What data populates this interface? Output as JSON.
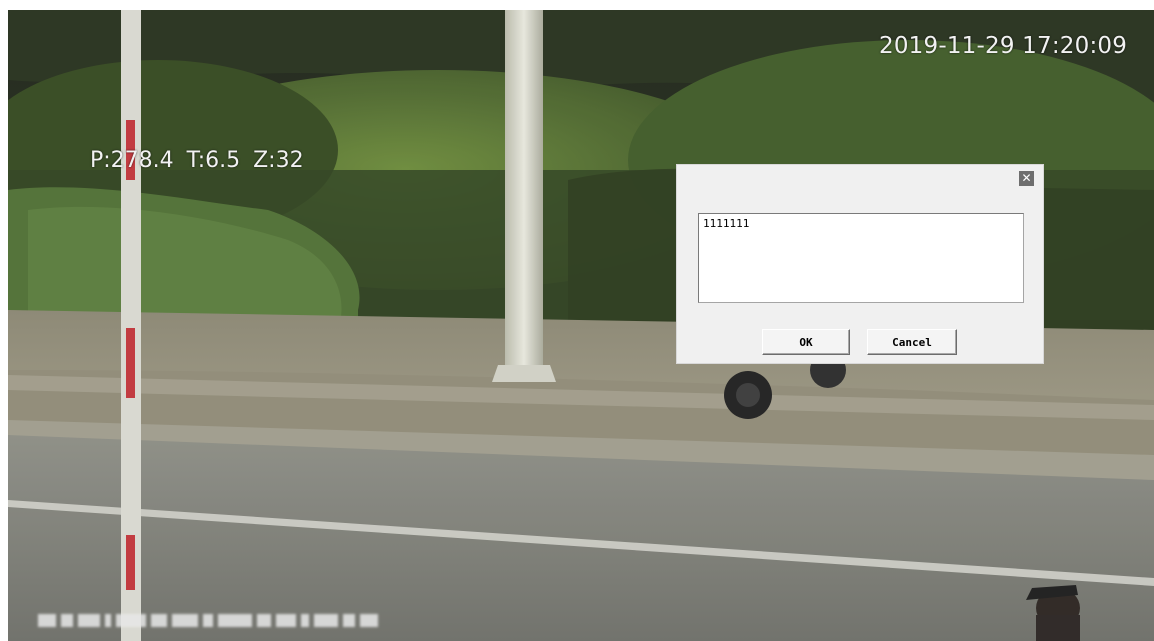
{
  "video": {
    "timestamp": "2019-11-29 17:20:09",
    "ptz": {
      "pan": "P:278.4",
      "tilt": "T:6.5",
      "zoom": "Z:32"
    }
  },
  "dialog": {
    "input_value": "1111111",
    "ok_label": "OK",
    "cancel_label": "Cancel",
    "close_glyph": "✕",
    "close_icon": "close-icon"
  },
  "colors": {
    "osd_text": "#f2f2f2",
    "dialog_background": "#f0f0f0",
    "close_button": "#6e6e6e"
  }
}
